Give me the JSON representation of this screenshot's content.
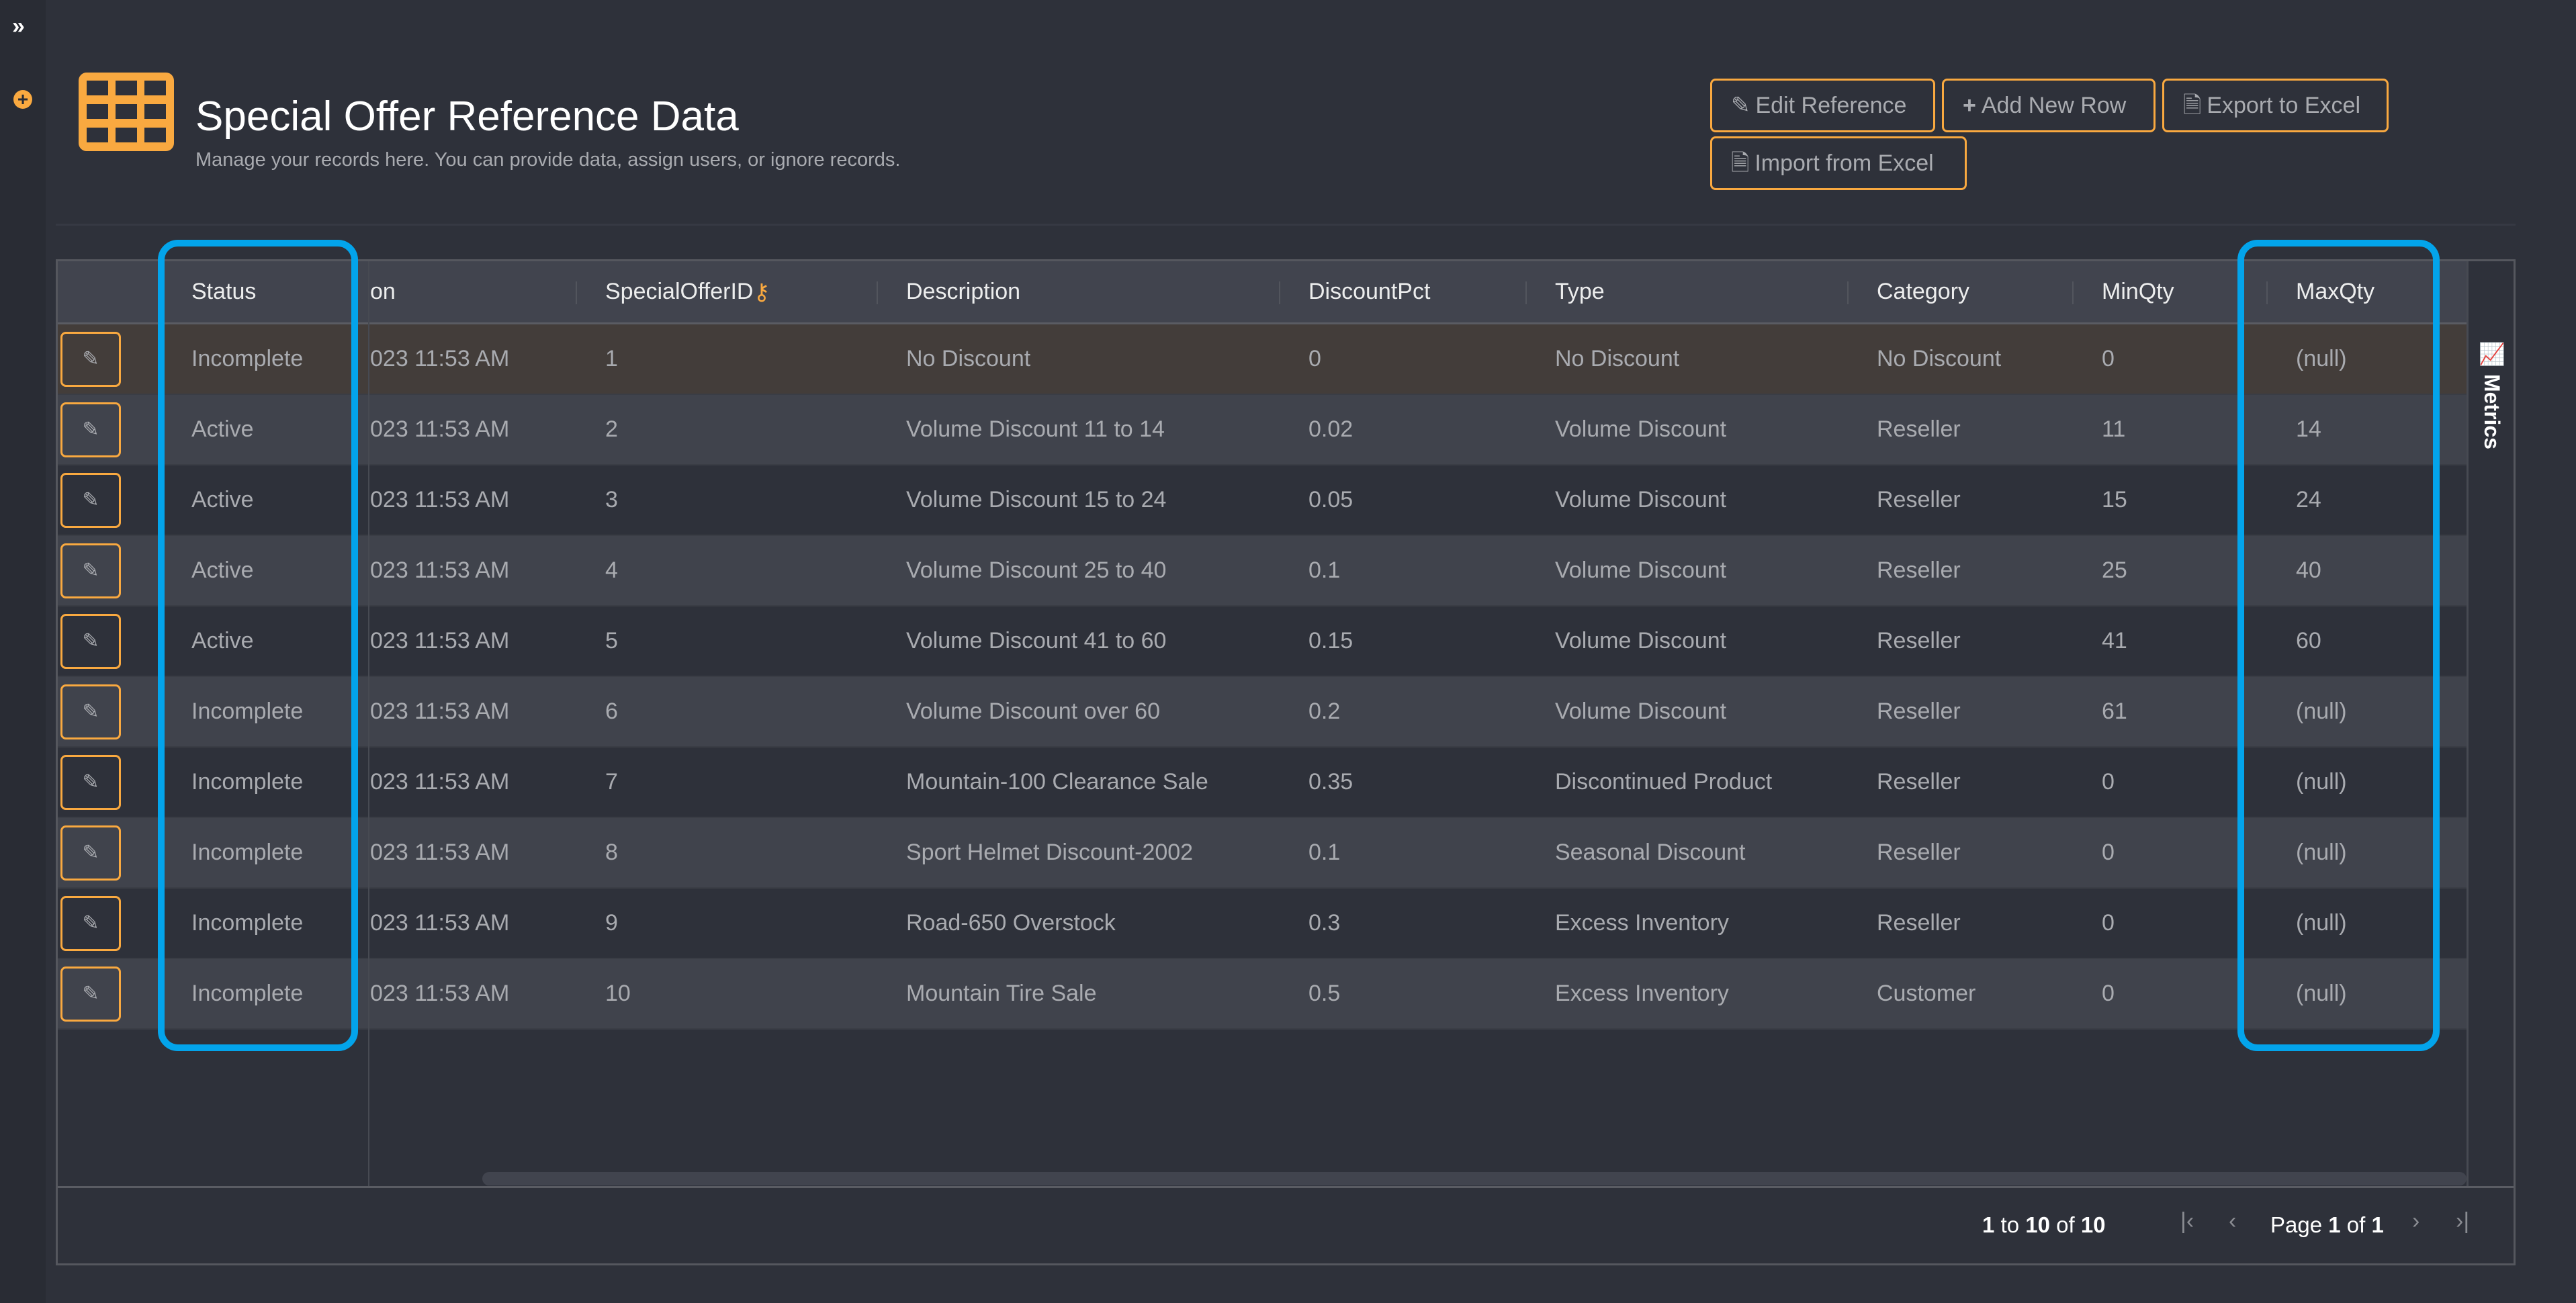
{
  "sidebar": {
    "expand_icon": "double-chevron-right-icon",
    "add_icon": "plus-circle-icon"
  },
  "header": {
    "title": "Special Offer Reference Data",
    "subtitle": "Manage your records here. You can provide data, assign users, or ignore records.",
    "logo_icon": "table-grid-icon"
  },
  "toolbar": {
    "edit_reference": "Edit Reference",
    "add_new_row": "Add New Row",
    "export_excel": "Export to Excel",
    "import_excel": "Import from Excel"
  },
  "table": {
    "columns": [
      "Status",
      "on",
      "SpecialOfferID",
      "Description",
      "DiscountPct",
      "Type",
      "Category",
      "MinQty",
      "MaxQty"
    ],
    "key_icon": "key-icon",
    "rows": [
      [
        "Incomplete",
        "023 11:53 AM",
        "1",
        "No Discount",
        "0",
        "No Discount",
        "No Discount",
        "0",
        "(null)"
      ],
      [
        "Active",
        "023 11:53 AM",
        "2",
        "Volume Discount 11 to 14",
        "0.02",
        "Volume Discount",
        "Reseller",
        "11",
        "14"
      ],
      [
        "Active",
        "023 11:53 AM",
        "3",
        "Volume Discount 15 to 24",
        "0.05",
        "Volume Discount",
        "Reseller",
        "15",
        "24"
      ],
      [
        "Active",
        "023 11:53 AM",
        "4",
        "Volume Discount 25 to 40",
        "0.1",
        "Volume Discount",
        "Reseller",
        "25",
        "40"
      ],
      [
        "Active",
        "023 11:53 AM",
        "5",
        "Volume Discount 41 to 60",
        "0.15",
        "Volume Discount",
        "Reseller",
        "41",
        "60"
      ],
      [
        "Incomplete",
        "023 11:53 AM",
        "6",
        "Volume Discount over 60",
        "0.2",
        "Volume Discount",
        "Reseller",
        "61",
        "(null)"
      ],
      [
        "Incomplete",
        "023 11:53 AM",
        "7",
        "Mountain-100 Clearance Sale",
        "0.35",
        "Discontinued Product",
        "Reseller",
        "0",
        "(null)"
      ],
      [
        "Incomplete",
        "023 11:53 AM",
        "8",
        "Sport Helmet Discount-2002",
        "0.1",
        "Seasonal Discount",
        "Reseller",
        "0",
        "(null)"
      ],
      [
        "Incomplete",
        "023 11:53 AM",
        "9",
        "Road-650 Overstock",
        "0.3",
        "Excess Inventory",
        "Reseller",
        "0",
        "(null)"
      ],
      [
        "Incomplete",
        "023 11:53 AM",
        "10",
        "Mountain Tire Sale",
        "0.5",
        "Excess Inventory",
        "Customer",
        "0",
        "(null)"
      ]
    ]
  },
  "metrics": {
    "label": "Metrics"
  },
  "pagination": {
    "from": "1",
    "to_word": "to",
    "to": "10",
    "of_word": "of",
    "total": "10",
    "page_word": "Page",
    "page": "1",
    "pages": "1"
  },
  "colors": {
    "accent": "#f9a940",
    "highlight": "#03a4eb",
    "background": "#2e313a",
    "selected_row": "#433d3a"
  }
}
